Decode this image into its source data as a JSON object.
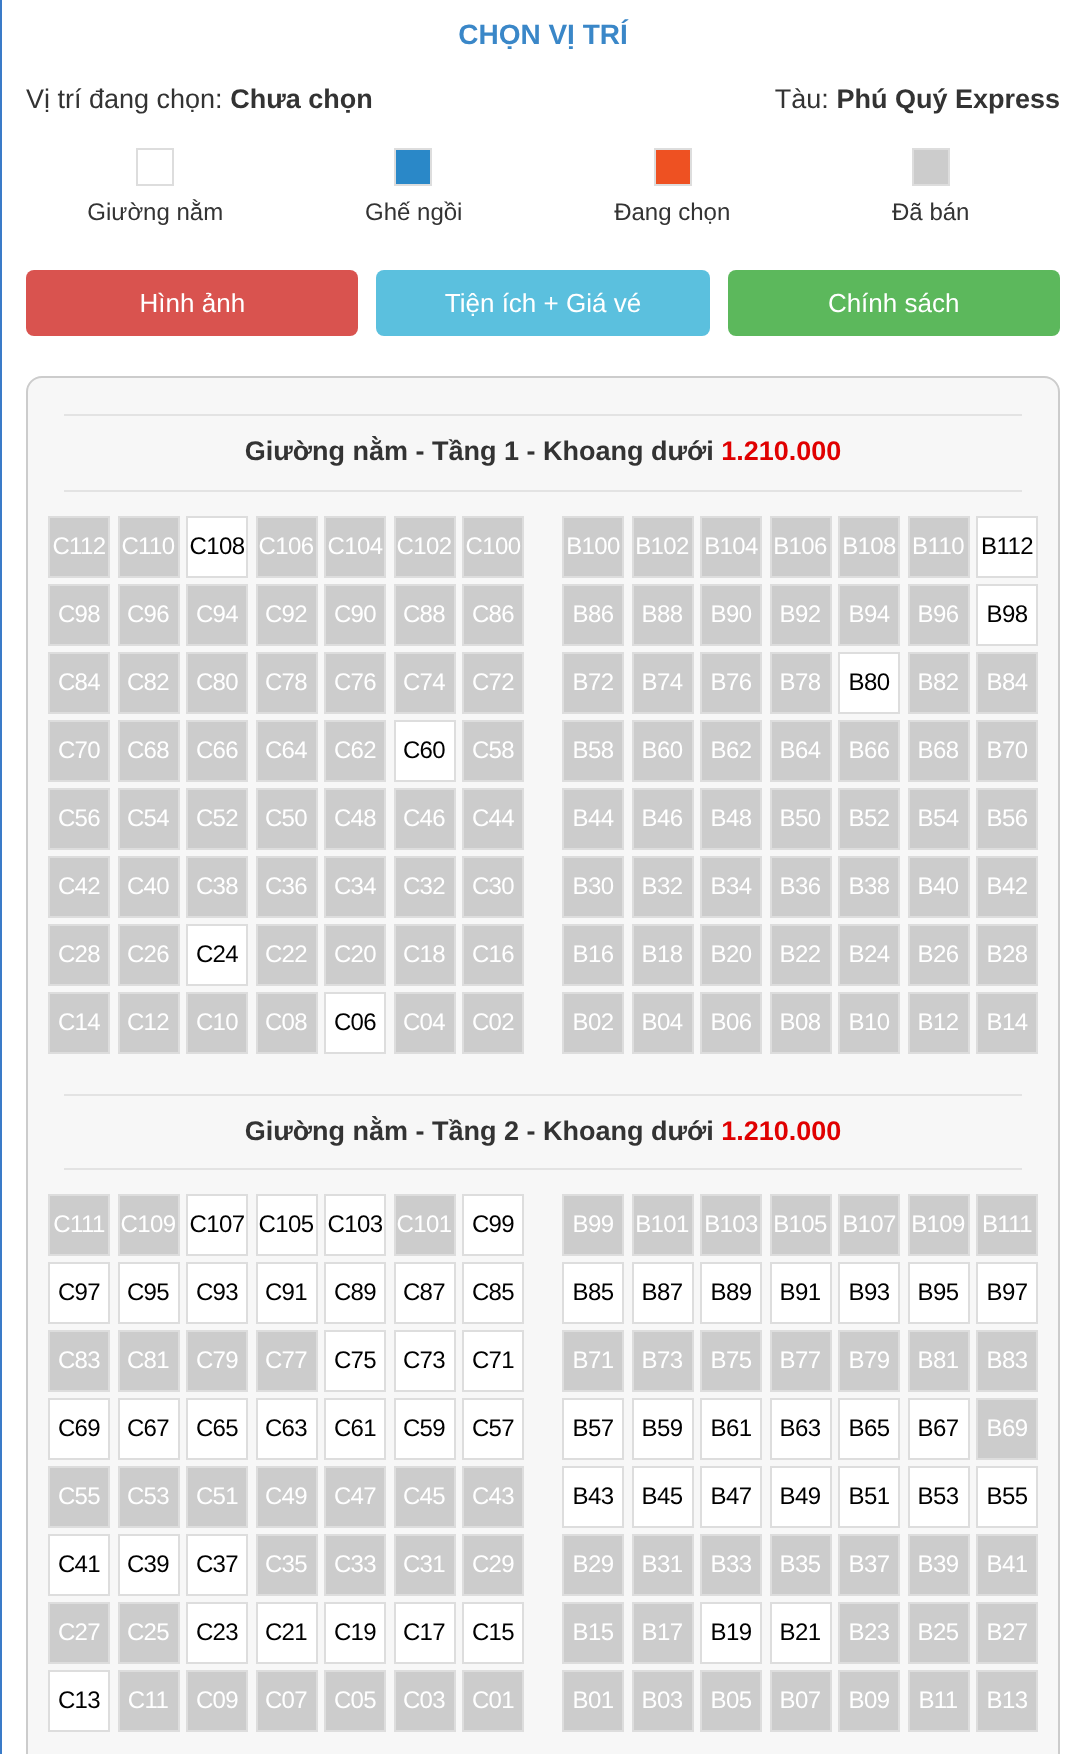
{
  "title": "CHỌN VỊ TRÍ",
  "info": {
    "position_label": "Vị trí đang chọn:",
    "position_value": "Chưa chọn",
    "ship_label": "Tàu:",
    "ship_value": "Phú Quý Express"
  },
  "legend": [
    {
      "label": "Giường nằm",
      "color": "#ffffff"
    },
    {
      "label": "Ghế ngồi",
      "color": "#2a88c8"
    },
    {
      "label": "Đang chọn",
      "color": "#ee5122"
    },
    {
      "label": "Đã bán",
      "color": "#cccccc"
    }
  ],
  "buttons": [
    {
      "label": "Hình ảnh",
      "color": "#d9534f"
    },
    {
      "label": "Tiện ích + Giá vé",
      "color": "#5bc0de"
    },
    {
      "label": "Chính sách",
      "color": "#5cb85c"
    }
  ],
  "decks": [
    {
      "title": "Giường nằm - Tầng 1 - Khoang dưới",
      "price": "1.210.000",
      "left": [
        [
          {
            "label": "C112",
            "sold": true
          },
          {
            "label": "C110",
            "sold": true
          },
          {
            "label": "C108",
            "sold": false
          },
          {
            "label": "C106",
            "sold": true
          },
          {
            "label": "C104",
            "sold": true
          },
          {
            "label": "C102",
            "sold": true
          },
          {
            "label": "C100",
            "sold": true
          }
        ],
        [
          {
            "label": "C98",
            "sold": true
          },
          {
            "label": "C96",
            "sold": true
          },
          {
            "label": "C94",
            "sold": true
          },
          {
            "label": "C92",
            "sold": true
          },
          {
            "label": "C90",
            "sold": true
          },
          {
            "label": "C88",
            "sold": true
          },
          {
            "label": "C86",
            "sold": true
          }
        ],
        [
          {
            "label": "C84",
            "sold": true
          },
          {
            "label": "C82",
            "sold": true
          },
          {
            "label": "C80",
            "sold": true
          },
          {
            "label": "C78",
            "sold": true
          },
          {
            "label": "C76",
            "sold": true
          },
          {
            "label": "C74",
            "sold": true
          },
          {
            "label": "C72",
            "sold": true
          }
        ],
        [
          {
            "label": "C70",
            "sold": true
          },
          {
            "label": "C68",
            "sold": true
          },
          {
            "label": "C66",
            "sold": true
          },
          {
            "label": "C64",
            "sold": true
          },
          {
            "label": "C62",
            "sold": true
          },
          {
            "label": "C60",
            "sold": false
          },
          {
            "label": "C58",
            "sold": true
          }
        ],
        [
          {
            "label": "C56",
            "sold": true
          },
          {
            "label": "C54",
            "sold": true
          },
          {
            "label": "C52",
            "sold": true
          },
          {
            "label": "C50",
            "sold": true
          },
          {
            "label": "C48",
            "sold": true
          },
          {
            "label": "C46",
            "sold": true
          },
          {
            "label": "C44",
            "sold": true
          }
        ],
        [
          {
            "label": "C42",
            "sold": true
          },
          {
            "label": "C40",
            "sold": true
          },
          {
            "label": "C38",
            "sold": true
          },
          {
            "label": "C36",
            "sold": true
          },
          {
            "label": "C34",
            "sold": true
          },
          {
            "label": "C32",
            "sold": true
          },
          {
            "label": "C30",
            "sold": true
          }
        ],
        [
          {
            "label": "C28",
            "sold": true
          },
          {
            "label": "C26",
            "sold": true
          },
          {
            "label": "C24",
            "sold": false
          },
          {
            "label": "C22",
            "sold": true
          },
          {
            "label": "C20",
            "sold": true
          },
          {
            "label": "C18",
            "sold": true
          },
          {
            "label": "C16",
            "sold": true
          }
        ],
        [
          {
            "label": "C14",
            "sold": true
          },
          {
            "label": "C12",
            "sold": true
          },
          {
            "label": "C10",
            "sold": true
          },
          {
            "label": "C08",
            "sold": true
          },
          {
            "label": "C06",
            "sold": false
          },
          {
            "label": "C04",
            "sold": true
          },
          {
            "label": "C02",
            "sold": true
          }
        ]
      ],
      "right": [
        [
          {
            "label": "B100",
            "sold": true
          },
          {
            "label": "B102",
            "sold": true
          },
          {
            "label": "B104",
            "sold": true
          },
          {
            "label": "B106",
            "sold": true
          },
          {
            "label": "B108",
            "sold": true
          },
          {
            "label": "B110",
            "sold": true
          },
          {
            "label": "B112",
            "sold": false
          }
        ],
        [
          {
            "label": "B86",
            "sold": true
          },
          {
            "label": "B88",
            "sold": true
          },
          {
            "label": "B90",
            "sold": true
          },
          {
            "label": "B92",
            "sold": true
          },
          {
            "label": "B94",
            "sold": true
          },
          {
            "label": "B96",
            "sold": true
          },
          {
            "label": "B98",
            "sold": false
          }
        ],
        [
          {
            "label": "B72",
            "sold": true
          },
          {
            "label": "B74",
            "sold": true
          },
          {
            "label": "B76",
            "sold": true
          },
          {
            "label": "B78",
            "sold": true
          },
          {
            "label": "B80",
            "sold": false
          },
          {
            "label": "B82",
            "sold": true
          },
          {
            "label": "B84",
            "sold": true
          }
        ],
        [
          {
            "label": "B58",
            "sold": true
          },
          {
            "label": "B60",
            "sold": true
          },
          {
            "label": "B62",
            "sold": true
          },
          {
            "label": "B64",
            "sold": true
          },
          {
            "label": "B66",
            "sold": true
          },
          {
            "label": "B68",
            "sold": true
          },
          {
            "label": "B70",
            "sold": true
          }
        ],
        [
          {
            "label": "B44",
            "sold": true
          },
          {
            "label": "B46",
            "sold": true
          },
          {
            "label": "B48",
            "sold": true
          },
          {
            "label": "B50",
            "sold": true
          },
          {
            "label": "B52",
            "sold": true
          },
          {
            "label": "B54",
            "sold": true
          },
          {
            "label": "B56",
            "sold": true
          }
        ],
        [
          {
            "label": "B30",
            "sold": true
          },
          {
            "label": "B32",
            "sold": true
          },
          {
            "label": "B34",
            "sold": true
          },
          {
            "label": "B36",
            "sold": true
          },
          {
            "label": "B38",
            "sold": true
          },
          {
            "label": "B40",
            "sold": true
          },
          {
            "label": "B42",
            "sold": true
          }
        ],
        [
          {
            "label": "B16",
            "sold": true
          },
          {
            "label": "B18",
            "sold": true
          },
          {
            "label": "B20",
            "sold": true
          },
          {
            "label": "B22",
            "sold": true
          },
          {
            "label": "B24",
            "sold": true
          },
          {
            "label": "B26",
            "sold": true
          },
          {
            "label": "B28",
            "sold": true
          }
        ],
        [
          {
            "label": "B02",
            "sold": true
          },
          {
            "label": "B04",
            "sold": true
          },
          {
            "label": "B06",
            "sold": true
          },
          {
            "label": "B08",
            "sold": true
          },
          {
            "label": "B10",
            "sold": true
          },
          {
            "label": "B12",
            "sold": true
          },
          {
            "label": "B14",
            "sold": true
          }
        ]
      ]
    },
    {
      "title": "Giường nằm - Tầng 2 - Khoang dưới",
      "price": "1.210.000",
      "left": [
        [
          {
            "label": "C111",
            "sold": true
          },
          {
            "label": "C109",
            "sold": true
          },
          {
            "label": "C107",
            "sold": false
          },
          {
            "label": "C105",
            "sold": false
          },
          {
            "label": "C103",
            "sold": false
          },
          {
            "label": "C101",
            "sold": true
          },
          {
            "label": "C99",
            "sold": false
          }
        ],
        [
          {
            "label": "C97",
            "sold": false
          },
          {
            "label": "C95",
            "sold": false
          },
          {
            "label": "C93",
            "sold": false
          },
          {
            "label": "C91",
            "sold": false
          },
          {
            "label": "C89",
            "sold": false
          },
          {
            "label": "C87",
            "sold": false
          },
          {
            "label": "C85",
            "sold": false
          }
        ],
        [
          {
            "label": "C83",
            "sold": true
          },
          {
            "label": "C81",
            "sold": true
          },
          {
            "label": "C79",
            "sold": true
          },
          {
            "label": "C77",
            "sold": true
          },
          {
            "label": "C75",
            "sold": false
          },
          {
            "label": "C73",
            "sold": false
          },
          {
            "label": "C71",
            "sold": false
          }
        ],
        [
          {
            "label": "C69",
            "sold": false
          },
          {
            "label": "C67",
            "sold": false
          },
          {
            "label": "C65",
            "sold": false
          },
          {
            "label": "C63",
            "sold": false
          },
          {
            "label": "C61",
            "sold": false
          },
          {
            "label": "C59",
            "sold": false
          },
          {
            "label": "C57",
            "sold": false
          }
        ],
        [
          {
            "label": "C55",
            "sold": true
          },
          {
            "label": "C53",
            "sold": true
          },
          {
            "label": "C51",
            "sold": true
          },
          {
            "label": "C49",
            "sold": true
          },
          {
            "label": "C47",
            "sold": true
          },
          {
            "label": "C45",
            "sold": true
          },
          {
            "label": "C43",
            "sold": true
          }
        ],
        [
          {
            "label": "C41",
            "sold": false
          },
          {
            "label": "C39",
            "sold": false
          },
          {
            "label": "C37",
            "sold": false
          },
          {
            "label": "C35",
            "sold": true
          },
          {
            "label": "C33",
            "sold": true
          },
          {
            "label": "C31",
            "sold": true
          },
          {
            "label": "C29",
            "sold": true
          }
        ],
        [
          {
            "label": "C27",
            "sold": true
          },
          {
            "label": "C25",
            "sold": true
          },
          {
            "label": "C23",
            "sold": false
          },
          {
            "label": "C21",
            "sold": false
          },
          {
            "label": "C19",
            "sold": false
          },
          {
            "label": "C17",
            "sold": false
          },
          {
            "label": "C15",
            "sold": false
          }
        ],
        [
          {
            "label": "C13",
            "sold": false
          },
          {
            "label": "C11",
            "sold": true
          },
          {
            "label": "C09",
            "sold": true
          },
          {
            "label": "C07",
            "sold": true
          },
          {
            "label": "C05",
            "sold": true
          },
          {
            "label": "C03",
            "sold": true
          },
          {
            "label": "C01",
            "sold": true
          }
        ]
      ],
      "right": [
        [
          {
            "label": "B99",
            "sold": true
          },
          {
            "label": "B101",
            "sold": true
          },
          {
            "label": "B103",
            "sold": true
          },
          {
            "label": "B105",
            "sold": true
          },
          {
            "label": "B107",
            "sold": true
          },
          {
            "label": "B109",
            "sold": true
          },
          {
            "label": "B111",
            "sold": true
          }
        ],
        [
          {
            "label": "B85",
            "sold": false
          },
          {
            "label": "B87",
            "sold": false
          },
          {
            "label": "B89",
            "sold": false
          },
          {
            "label": "B91",
            "sold": false
          },
          {
            "label": "B93",
            "sold": false
          },
          {
            "label": "B95",
            "sold": false
          },
          {
            "label": "B97",
            "sold": false
          }
        ],
        [
          {
            "label": "B71",
            "sold": true
          },
          {
            "label": "B73",
            "sold": true
          },
          {
            "label": "B75",
            "sold": true
          },
          {
            "label": "B77",
            "sold": true
          },
          {
            "label": "B79",
            "sold": true
          },
          {
            "label": "B81",
            "sold": true
          },
          {
            "label": "B83",
            "sold": true
          }
        ],
        [
          {
            "label": "B57",
            "sold": false
          },
          {
            "label": "B59",
            "sold": false
          },
          {
            "label": "B61",
            "sold": false
          },
          {
            "label": "B63",
            "sold": false
          },
          {
            "label": "B65",
            "sold": false
          },
          {
            "label": "B67",
            "sold": false
          },
          {
            "label": "B69",
            "sold": true
          }
        ],
        [
          {
            "label": "B43",
            "sold": false
          },
          {
            "label": "B45",
            "sold": false
          },
          {
            "label": "B47",
            "sold": false
          },
          {
            "label": "B49",
            "sold": false
          },
          {
            "label": "B51",
            "sold": false
          },
          {
            "label": "B53",
            "sold": false
          },
          {
            "label": "B55",
            "sold": false
          }
        ],
        [
          {
            "label": "B29",
            "sold": true
          },
          {
            "label": "B31",
            "sold": true
          },
          {
            "label": "B33",
            "sold": true
          },
          {
            "label": "B35",
            "sold": true
          },
          {
            "label": "B37",
            "sold": true
          },
          {
            "label": "B39",
            "sold": true
          },
          {
            "label": "B41",
            "sold": true
          }
        ],
        [
          {
            "label": "B15",
            "sold": true
          },
          {
            "label": "B17",
            "sold": true
          },
          {
            "label": "B19",
            "sold": false
          },
          {
            "label": "B21",
            "sold": false
          },
          {
            "label": "B23",
            "sold": true
          },
          {
            "label": "B25",
            "sold": true
          },
          {
            "label": "B27",
            "sold": true
          }
        ],
        [
          {
            "label": "B01",
            "sold": true
          },
          {
            "label": "B03",
            "sold": true
          },
          {
            "label": "B05",
            "sold": true
          },
          {
            "label": "B07",
            "sold": true
          },
          {
            "label": "B09",
            "sold": true
          },
          {
            "label": "B11",
            "sold": true
          },
          {
            "label": "B13",
            "sold": true
          }
        ]
      ]
    }
  ]
}
